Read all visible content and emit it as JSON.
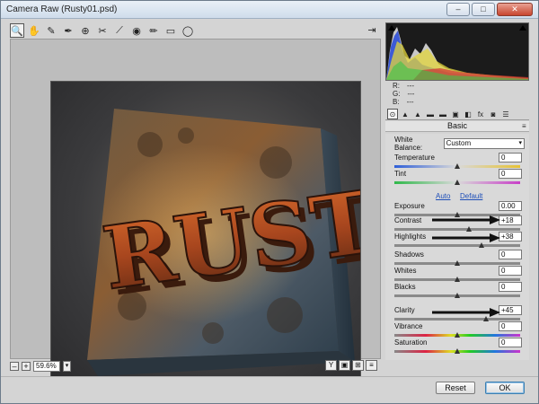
{
  "window": {
    "title": "Camera Raw (Rusty01.psd)",
    "minimize": "–",
    "maximize": "□",
    "close": "✕"
  },
  "toolbar": {
    "tools": [
      {
        "name": "zoom-tool",
        "glyph": "🔍"
      },
      {
        "name": "hand-tool",
        "glyph": "✋"
      },
      {
        "name": "white-balance-tool",
        "glyph": "✎"
      },
      {
        "name": "color-sampler-tool",
        "glyph": "✒"
      },
      {
        "name": "targeted-adjustment-tool",
        "glyph": "⊕"
      },
      {
        "name": "crop-tool",
        "glyph": "✂"
      },
      {
        "name": "straighten-tool",
        "glyph": "⟋"
      },
      {
        "name": "red-eye-tool",
        "glyph": "◉"
      },
      {
        "name": "adjustment-brush-tool",
        "glyph": "✏"
      },
      {
        "name": "graduated-filter-tool",
        "glyph": "▭"
      },
      {
        "name": "radial-filter-tool",
        "glyph": "◯"
      }
    ],
    "open_preferences": "⇥"
  },
  "preview": {
    "artwork_text": "RUST"
  },
  "status": {
    "zoom_minus": "–",
    "zoom_plus": "+",
    "zoom_value": "59.6%",
    "zoom_caret": "▾",
    "view_buttons": [
      "Y",
      "▣",
      "⊞",
      "≡"
    ]
  },
  "histogram": {
    "readout": [
      {
        "ch": "R:",
        "v": "---"
      },
      {
        "ch": "G:",
        "v": "---"
      },
      {
        "ch": "B:",
        "v": "---"
      }
    ]
  },
  "panel": {
    "tabs": [
      "⊙",
      "▲",
      "▲",
      "▬",
      "▬",
      "▣",
      "◧",
      "fx",
      "◙",
      "☰"
    ],
    "heading": "Basic",
    "menu_icon": "≡",
    "white_balance": {
      "label": "White Balance:",
      "value": "Custom",
      "caret": "▾"
    },
    "sliders": [
      {
        "label": "Temperature",
        "value": "0",
        "pos": 0.5,
        "track": "temp"
      },
      {
        "label": "Tint",
        "value": "0",
        "pos": 0.5,
        "track": "tint"
      },
      {
        "label": "Exposure",
        "value": "0.00",
        "pos": 0.5,
        "track": "gray"
      },
      {
        "label": "Contrast",
        "value": "+18",
        "pos": 0.59,
        "track": "gray"
      },
      {
        "label": "Highlights",
        "value": "+38",
        "pos": 0.69,
        "track": "gray"
      },
      {
        "label": "Shadows",
        "value": "0",
        "pos": 0.5,
        "track": "gray"
      },
      {
        "label": "Whites",
        "value": "0",
        "pos": 0.5,
        "track": "gray"
      },
      {
        "label": "Blacks",
        "value": "0",
        "pos": 0.5,
        "track": "gray"
      },
      {
        "label": "Clarity",
        "value": "+45",
        "pos": 0.73,
        "track": "gray"
      },
      {
        "label": "Vibrance",
        "value": "0",
        "pos": 0.5,
        "track": "vib"
      },
      {
        "label": "Saturation",
        "value": "0",
        "pos": 0.5,
        "track": "sat"
      }
    ],
    "auto_label": "Auto",
    "default_label": "Default"
  },
  "footer": {
    "reset_label": "Reset",
    "ok_label": "OK"
  },
  "colors": {
    "accent_link": "#1f4fb8",
    "ok_border": "#3c7fb1",
    "window_bg": "#d4d4d4"
  }
}
